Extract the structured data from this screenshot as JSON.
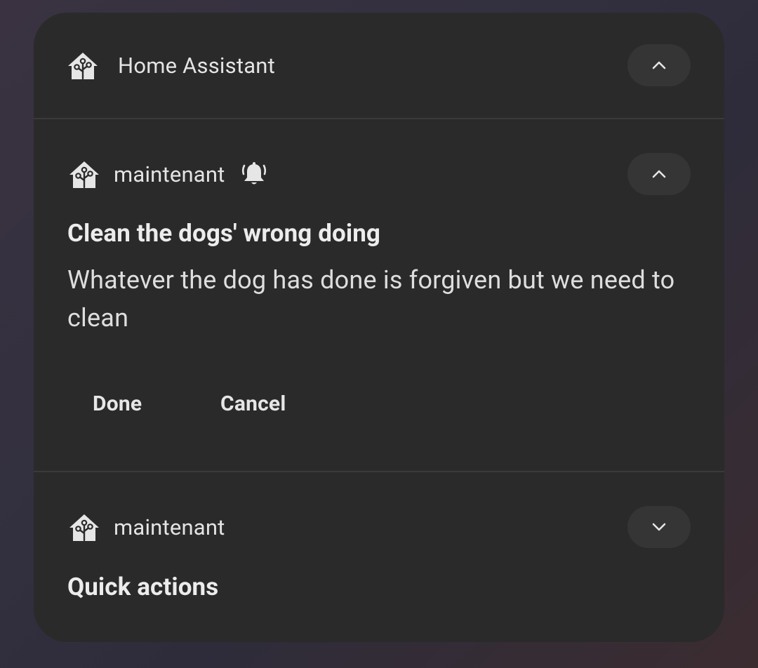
{
  "group": {
    "app_name": "Home Assistant",
    "app_icon": "home-assistant-icon",
    "toggle_icon": "chevron-up-icon"
  },
  "notifications": [
    {
      "channel": "maintenant",
      "app_icon": "home-assistant-icon",
      "alert_icon": "bell-ringing-icon",
      "toggle_icon": "chevron-up-icon",
      "title": "Clean the dogs' wrong doing",
      "body": "Whatever the dog has done is forgiven but we need to clean",
      "actions": [
        {
          "label": "Done"
        },
        {
          "label": "Cancel"
        }
      ]
    },
    {
      "channel": "maintenant",
      "app_icon": "home-assistant-icon",
      "toggle_icon": "chevron-down-icon",
      "title": "Quick actions"
    }
  ],
  "colors": {
    "card": "#2a2a2a",
    "chip": "#353535",
    "text": "#e6e6e6"
  }
}
